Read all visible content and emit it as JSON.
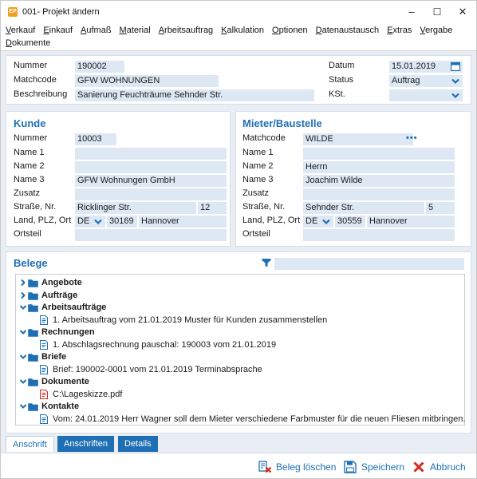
{
  "window": {
    "app_icon_text": "EP",
    "title": "001- Projekt ändern",
    "minimize": "–",
    "maximize": "☐",
    "close": "✕"
  },
  "menu": [
    "Verkauf",
    "Einkauf",
    "Aufmaß",
    "Material",
    "Arbeitsauftrag",
    "Kalkulation",
    "Optionen",
    "Datenaustausch",
    "Extras",
    "Vergabe",
    "Dokumente"
  ],
  "header": {
    "nummer_label": "Nummer",
    "nummer_value": "190002",
    "matchcode_label": "Matchcode",
    "matchcode_value": "GFW WOHNUNGEN",
    "beschreibung_label": "Beschreibung",
    "beschreibung_value": "Sanierung Feuchträume Sehnder Str.",
    "datum_label": "Datum",
    "datum_value": "15.01.2019",
    "status_label": "Status",
    "status_value": "Auftrag",
    "kst_label": "KSt.",
    "kst_value": ""
  },
  "kunde": {
    "title": "Kunde",
    "nummer_label": "Nummer",
    "nummer_value": "10003",
    "name1_label": "Name 1",
    "name1_value": "",
    "name2_label": "Name 2",
    "name2_value": "",
    "name3_label": "Name 3",
    "name3_value": "GFW Wohnungen GmbH",
    "zusatz_label": "Zusatz",
    "zusatz_value": "",
    "strasse_label": "Straße, Nr.",
    "strasse_value": "Ricklinger Str.",
    "hausnr_value": "12",
    "land_label": "Land, PLZ, Ort",
    "land_value": "DE",
    "plz_value": "30169",
    "ort_value": "Hannover",
    "ortsteil_label": "Ortsteil",
    "ortsteil_value": ""
  },
  "mieter": {
    "title": "Mieter/Baustelle",
    "matchcode_label": "Matchcode",
    "matchcode_value": "WILDE",
    "name1_label": "Name 1",
    "name1_value": "",
    "name2_label": "Name 2",
    "name2_value": "Herrn",
    "name3_label": "Name 3",
    "name3_value": "Joachim Wilde",
    "zusatz_label": "Zusatz",
    "zusatz_value": "",
    "strasse_label": "Straße, Nr.",
    "strasse_value": "Sehnder Str.",
    "hausnr_value": "5",
    "land_label": "Land, PLZ, Ort",
    "land_value": "DE",
    "plz_value": "30559",
    "ort_value": "Hannover",
    "ortsteil_label": "Ortsteil",
    "ortsteil_value": ""
  },
  "belege": {
    "title": "Belege",
    "filter_value": "",
    "tree": [
      {
        "kind": "folder",
        "expanded": false,
        "text": "Angebote"
      },
      {
        "kind": "folder",
        "expanded": false,
        "text": "Aufträge"
      },
      {
        "kind": "folder",
        "expanded": true,
        "text": "Arbeitsaufträge"
      },
      {
        "kind": "doc",
        "text": "1. Arbeitsauftrag vom 21.01.2019 Muster für Kunden zusammenstellen"
      },
      {
        "kind": "folder",
        "expanded": true,
        "text": "Rechnungen"
      },
      {
        "kind": "doc",
        "text": "1. Abschlagsrechnung pauschal: 190003 vom 21.01.2019"
      },
      {
        "kind": "folder",
        "expanded": true,
        "text": "Briefe"
      },
      {
        "kind": "doc",
        "text": "Brief: 190002-0001 vom 21.01.2019 Terminabsprache"
      },
      {
        "kind": "folder",
        "expanded": true,
        "text": "Dokumente"
      },
      {
        "kind": "pdf",
        "text": "C:\\Lageskizze.pdf"
      },
      {
        "kind": "folder",
        "expanded": true,
        "text": "Kontakte"
      },
      {
        "kind": "doc",
        "text": "Vom: 24.01.2019  Herr Wagner soll dem Mieter verschiedene Farbmuster für die neuen Fliesen mitbringen."
      }
    ]
  },
  "tabs": [
    "Anschrift",
    "Anschriften",
    "Details"
  ],
  "actions": {
    "delete": "Beleg löschen",
    "save": "Speichern",
    "cancel": "Abbruch"
  },
  "colors": {
    "accent": "#1e6fb3",
    "field": "#dde8f4",
    "background": "#e9eef5",
    "cancel_red": "#d9261c"
  }
}
